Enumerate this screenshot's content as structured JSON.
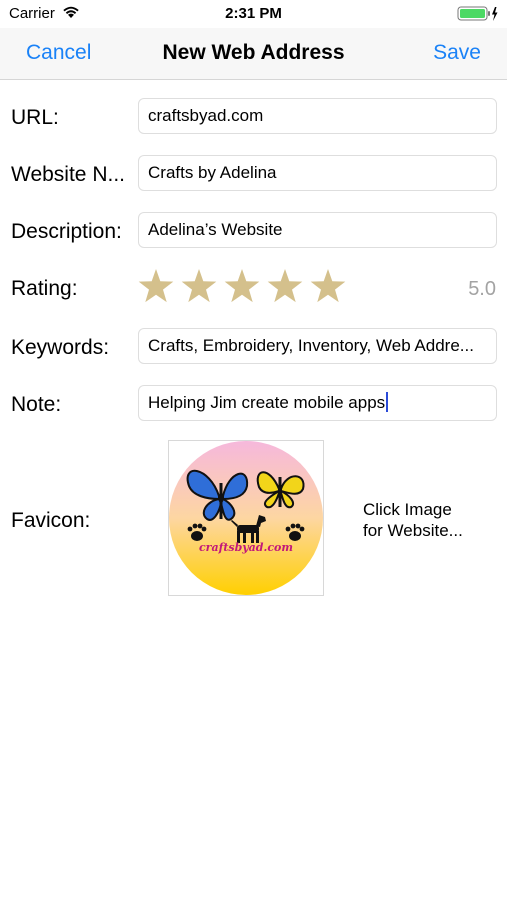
{
  "status_bar": {
    "carrier": "Carrier",
    "time": "2:31 PM",
    "wifi_icon": "wifi-icon",
    "battery_icon": "battery-charging-icon"
  },
  "nav": {
    "cancel_label": "Cancel",
    "title": "New Web Address",
    "save_label": "Save"
  },
  "form": {
    "url": {
      "label": "URL:",
      "value": "craftsbyad.com"
    },
    "website_name": {
      "label": "Website N...",
      "value": "Crafts by Adelina"
    },
    "description": {
      "label": "Description:",
      "value": "Adelina’s Website"
    },
    "rating": {
      "label": "Rating:",
      "value_text": "5.0",
      "value": 5,
      "max": 5
    },
    "keywords": {
      "label": "Keywords:",
      "value": "Crafts, Embroidery, Inventory, Web Addre..."
    },
    "note": {
      "label": "Note:",
      "value": "Helping Jim create mobile apps"
    },
    "favicon": {
      "label": "Favicon:",
      "image_text": "craftsbyad.com",
      "hint_line1": "Click Image",
      "hint_line2": "for Website..."
    }
  },
  "colors": {
    "accent": "#1a82f7",
    "star": "#d4c08c",
    "battery": "#4cd964"
  }
}
